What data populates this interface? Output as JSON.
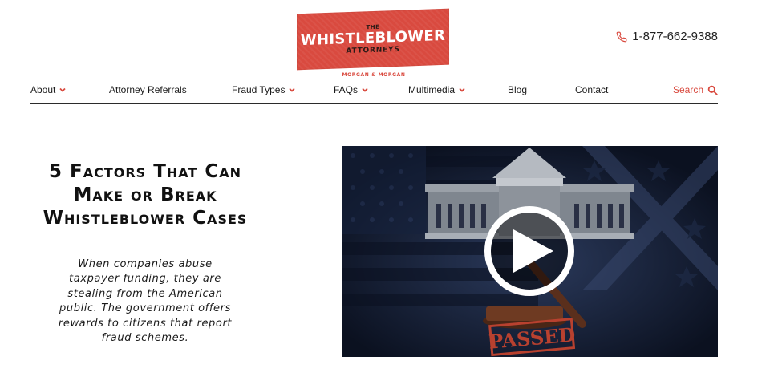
{
  "header": {
    "logo": {
      "top": "THE",
      "main": "WHISTLEBLOWER",
      "sub": "ATTORNEYS",
      "firm": "MORGAN & MORGAN"
    },
    "phone": {
      "icon": "phone-icon",
      "number": "1-877-662-9388"
    }
  },
  "nav": {
    "items": [
      {
        "label": "About",
        "dropdown": true
      },
      {
        "label": "Attorney Referrals",
        "dropdown": false
      },
      {
        "label": "Fraud Types",
        "dropdown": true
      },
      {
        "label": "FAQs",
        "dropdown": true
      },
      {
        "label": "Multimedia",
        "dropdown": true
      },
      {
        "label": "Blog",
        "dropdown": false
      },
      {
        "label": "Contact",
        "dropdown": false
      }
    ],
    "search": {
      "label": "Search",
      "icon": "search-icon"
    }
  },
  "hero": {
    "title": "5 Factors That Can Make or Break Whistleblower Cases",
    "description": "When companies abuse taxpayer funding, they are stealing from the American public. The government offers rewards to citizens that report fraud schemes.",
    "video": {
      "stamp_text": "PASSED",
      "play_icon": "play-icon"
    }
  },
  "colors": {
    "brand_red": "#d94a3f",
    "text_dark": "#1a1a1a",
    "video_bg": "#0e1526"
  }
}
